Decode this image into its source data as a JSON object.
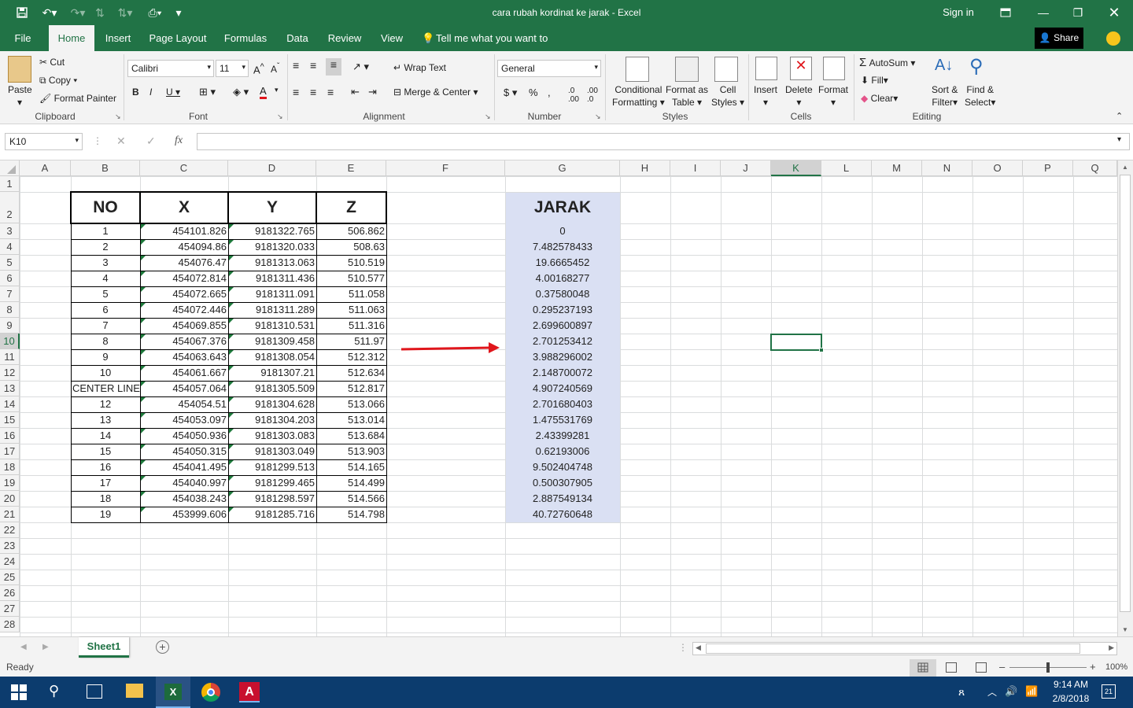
{
  "window": {
    "title": "cara rubah kordinat ke jarak  -  Excel",
    "sign_in": "Sign in"
  },
  "tabs": [
    "File",
    "Home",
    "Insert",
    "Page Layout",
    "Formulas",
    "Data",
    "Review",
    "View"
  ],
  "tell_me": "Tell me what you want to do",
  "share": "Share",
  "ribbon": {
    "clipboard": {
      "paste": "Paste",
      "cut": "Cut",
      "copy": "Copy",
      "format_painter": "Format Painter",
      "label": "Clipboard"
    },
    "font": {
      "name": "Calibri",
      "size": "11",
      "label": "Font"
    },
    "alignment": {
      "wrap": "Wrap Text",
      "merge": "Merge & Center",
      "label": "Alignment"
    },
    "number": {
      "format": "General",
      "label": "Number"
    },
    "styles": {
      "cond1": "Conditional",
      "cond2": "Formatting",
      "fat1": "Format as",
      "fat2": "Table",
      "cs1": "Cell",
      "cs2": "Styles",
      "label": "Styles"
    },
    "cells": {
      "insert": "Insert",
      "delete": "Delete",
      "format": "Format",
      "label": "Cells"
    },
    "editing": {
      "autosum": "AutoSum",
      "fill": "Fill",
      "clear": "Clear",
      "sort1": "Sort &",
      "sort2": "Filter",
      "find1": "Find &",
      "find2": "Select",
      "label": "Editing"
    }
  },
  "formula_bar": {
    "name_box": "K10",
    "fx": "fx",
    "value": ""
  },
  "columns": [
    "A",
    "B",
    "C",
    "D",
    "E",
    "F",
    "G",
    "H",
    "I",
    "J",
    "K",
    "L",
    "M",
    "N",
    "O",
    "P",
    "Q"
  ],
  "rows": [
    "1",
    "2",
    "3",
    "4",
    "5",
    "6",
    "7",
    "8",
    "9",
    "10",
    "11",
    "12",
    "13",
    "14",
    "15",
    "16",
    "17",
    "18",
    "19",
    "20",
    "21",
    "22",
    "23",
    "24",
    "25",
    "26",
    "27",
    "28"
  ],
  "headers": {
    "no": "NO",
    "x": "X",
    "y": "Y",
    "z": "Z",
    "jarak": "JARAK"
  },
  "table": [
    {
      "no": "1",
      "x": "454101.826",
      "y": "9181322.765",
      "z": "506.862",
      "j": "0"
    },
    {
      "no": "2",
      "x": "454094.86",
      "y": "9181320.033",
      "z": "508.63",
      "j": "7.482578433"
    },
    {
      "no": "3",
      "x": "454076.47",
      "y": "9181313.063",
      "z": "510.519",
      "j": "19.6665452"
    },
    {
      "no": "4",
      "x": "454072.814",
      "y": "9181311.436",
      "z": "510.577",
      "j": "4.00168277"
    },
    {
      "no": "5",
      "x": "454072.665",
      "y": "9181311.091",
      "z": "511.058",
      "j": "0.37580048"
    },
    {
      "no": "6",
      "x": "454072.446",
      "y": "9181311.289",
      "z": "511.063",
      "j": "0.295237193"
    },
    {
      "no": "7",
      "x": "454069.855",
      "y": "9181310.531",
      "z": "511.316",
      "j": "2.699600897"
    },
    {
      "no": "8",
      "x": "454067.376",
      "y": "9181309.458",
      "z": "511.97",
      "j": "2.701253412"
    },
    {
      "no": "9",
      "x": "454063.643",
      "y": "9181308.054",
      "z": "512.312",
      "j": "3.988296002"
    },
    {
      "no": "10",
      "x": "454061.667",
      "y": "9181307.21",
      "z": "512.634",
      "j": "2.148700072"
    },
    {
      "no": "CENTER LINE",
      "x": "454057.064",
      "y": "9181305.509",
      "z": "512.817",
      "j": "4.907240569"
    },
    {
      "no": "12",
      "x": "454054.51",
      "y": "9181304.628",
      "z": "513.066",
      "j": "2.701680403"
    },
    {
      "no": "13",
      "x": "454053.097",
      "y": "9181304.203",
      "z": "513.014",
      "j": "1.475531769"
    },
    {
      "no": "14",
      "x": "454050.936",
      "y": "9181303.083",
      "z": "513.684",
      "j": "2.43399281"
    },
    {
      "no": "15",
      "x": "454050.315",
      "y": "9181303.049",
      "z": "513.903",
      "j": "0.62193006"
    },
    {
      "no": "16",
      "x": "454041.495",
      "y": "9181299.513",
      "z": "514.165",
      "j": "9.502404748"
    },
    {
      "no": "17",
      "x": "454040.997",
      "y": "9181299.465",
      "z": "514.499",
      "j": "0.500307905"
    },
    {
      "no": "18",
      "x": "454038.243",
      "y": "9181298.597",
      "z": "514.566",
      "j": "2.887549134"
    },
    {
      "no": "19",
      "x": "453999.606",
      "y": "9181285.716",
      "z": "514.798",
      "j": "40.72760648"
    }
  ],
  "sheet_tab": "Sheet1",
  "status": {
    "ready": "Ready",
    "zoom": "100%"
  },
  "taskbar": {
    "time": "9:14 AM",
    "date": "2/8/2018",
    "notif": "21"
  },
  "colors": {
    "excel_green": "#217346",
    "jarak_fill": "#dae0f3",
    "arrow": "#e0161c",
    "taskbar": "#0c3c6e"
  }
}
